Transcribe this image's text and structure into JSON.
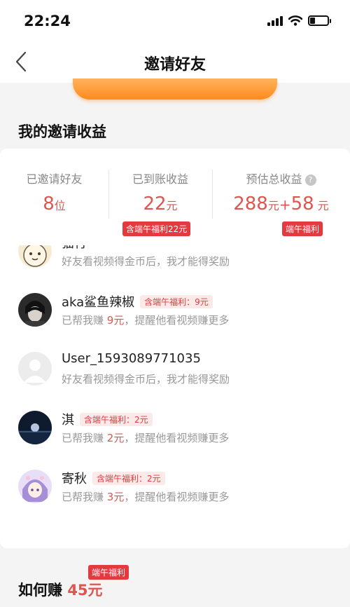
{
  "status_bar": {
    "time": "22:24",
    "battery_level": 0.3
  },
  "nav": {
    "title": "邀请好友",
    "back_icon": "chevron-left-icon"
  },
  "section": {
    "title": "我的邀请收益"
  },
  "stats": {
    "invited": {
      "label": "已邀请好友",
      "value": "8",
      "unit": "位"
    },
    "received": {
      "label": "已到账收益",
      "value": "22",
      "unit": "元",
      "badge": "含端午福利22元"
    },
    "estimated": {
      "label": "预估总收益",
      "help": "?",
      "value": "288",
      "unit": "元",
      "plus": "+",
      "bonus_value": "58",
      "bonus_unit": "元",
      "badge": "端午福利"
    }
  },
  "friends": [
    {
      "name": "猫行",
      "desc": "好友看视频得金币后，我才能得奖励",
      "avatar": "cartoon-cat"
    },
    {
      "name": "aka鲨鱼辣椒",
      "badge": "含端午福利：9元",
      "desc_prefix": "已帮我赚 ",
      "amount": "9元",
      "desc_suffix": "，提醒他看视频赚更多",
      "avatar": "dark-anime"
    },
    {
      "name": "User_1593089771035",
      "desc": "好友看视频得金币后，我才能得奖励",
      "avatar": "default-user"
    },
    {
      "name": "淇",
      "badge": "含端午福利：2元",
      "desc_prefix": "已帮我赚 ",
      "amount": "2元",
      "desc_suffix": "，提醒他看视频赚更多",
      "avatar": "night-scene"
    },
    {
      "name": "寄秋",
      "badge": "含端午福利：2元",
      "desc_prefix": "已帮我赚 ",
      "amount": "3元",
      "desc_suffix": "，提醒他看视频赚更多",
      "avatar": "anime-girl"
    }
  ],
  "how_to_earn": {
    "prefix": "如何赚 ",
    "amount": "45元",
    "badge": "端午福利"
  },
  "colors": {
    "accent": "#e0554f",
    "badge_red": "#e33a3f",
    "orange": "#ff8a1d"
  }
}
